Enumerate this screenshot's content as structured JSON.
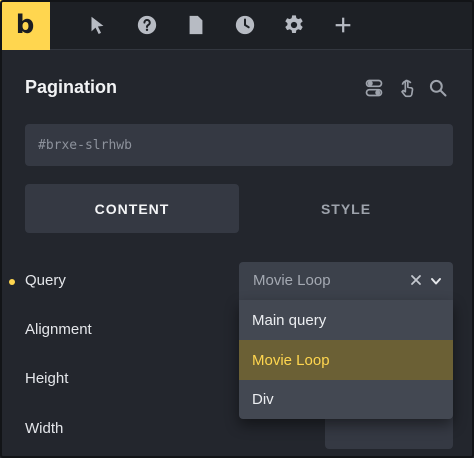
{
  "toolbar": {
    "logo_text": "b",
    "icons": [
      "pointer-icon",
      "help-icon",
      "page-icon",
      "history-icon",
      "settings-icon",
      "add-icon"
    ]
  },
  "panel": {
    "title": "Pagination",
    "css_id_value": "#brxe-slrhwb",
    "tabs": [
      {
        "label": "CONTENT",
        "active": true
      },
      {
        "label": "STYLE",
        "active": false
      }
    ]
  },
  "controls": {
    "query_label": "Query",
    "alignment_label": "Alignment",
    "height_label": "Height",
    "width_label": "Width"
  },
  "query_select": {
    "value": "Movie Loop",
    "options": [
      {
        "label": "Main query",
        "selected": false
      },
      {
        "label": "Movie Loop",
        "selected": true
      },
      {
        "label": "Div",
        "selected": false
      }
    ]
  },
  "colors": {
    "accent": "#ffd64f",
    "panel_bg": "#23262d",
    "field_bg": "#353943",
    "selected_option_bg": "#6b6035"
  }
}
